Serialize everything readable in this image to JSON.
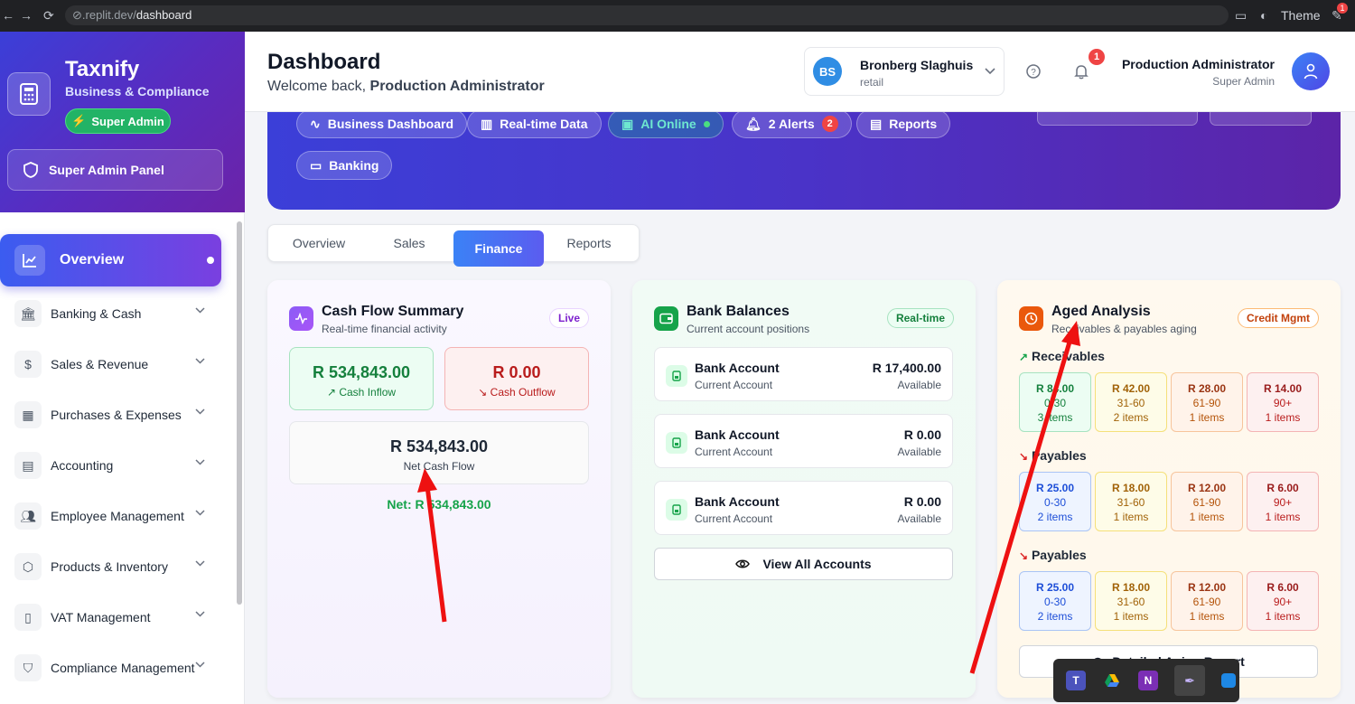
{
  "browser": {
    "url_prefix": ".replit.dev/",
    "url_path": "dashboard",
    "theme_label": "Theme",
    "ext_badge": "1"
  },
  "sidebar": {
    "brand": "Taxnify",
    "brand_sub": "Business & Compliance",
    "role_badge": "Super Admin",
    "admin_panel": "Super Admin Panel",
    "active_item": "Overview",
    "items": [
      {
        "label": "Banking & Cash",
        "icon": "bank-icon"
      },
      {
        "label": "Sales & Revenue",
        "icon": "dollar-icon"
      },
      {
        "label": "Purchases & Expenses",
        "icon": "receipt-icon"
      },
      {
        "label": "Accounting",
        "icon": "calculator-icon"
      },
      {
        "label": "Employee Management",
        "icon": "users-icon"
      },
      {
        "label": "Products & Inventory",
        "icon": "box-icon"
      },
      {
        "label": "VAT Management",
        "icon": "document-icon"
      },
      {
        "label": "Compliance Management",
        "icon": "shield-icon"
      }
    ]
  },
  "header": {
    "title": "Dashboard",
    "welcome_prefix": "Welcome back, ",
    "welcome_name": "Production Administrator",
    "company_initials": "BS",
    "company_name": "Bronberg Slaghuis",
    "company_type": "retail",
    "notifications": "1",
    "user_name": "Production Administrator",
    "user_role": "Super Admin"
  },
  "hero": {
    "pills": [
      "Business Dashboard",
      "Real-time Data",
      "AI Online",
      "2 Alerts",
      "Reports",
      "Banking"
    ],
    "alerts_count": "2"
  },
  "tabs": [
    "Overview",
    "Sales",
    "Finance",
    "Reports"
  ],
  "active_tab": "Finance",
  "cashflow": {
    "title": "Cash Flow Summary",
    "subtitle": "Real-time financial activity",
    "tag": "Live",
    "inflow": "R 534,843.00",
    "inflow_label": "Cash Inflow",
    "outflow": "R 0.00",
    "outflow_label": "Cash Outflow",
    "net": "R 534,843.00",
    "net_label": "Net Cash Flow",
    "net_line": "Net: R 534,843.00"
  },
  "bank": {
    "title": "Bank Balances",
    "subtitle": "Current account positions",
    "tag": "Real-time",
    "accounts": [
      {
        "name": "Bank Account",
        "type": "Current Account",
        "amount": "R 17,400.00",
        "status": "Available"
      },
      {
        "name": "Bank Account",
        "type": "Current Account",
        "amount": "R 0.00",
        "status": "Available"
      },
      {
        "name": "Bank Account",
        "type": "Current Account",
        "amount": "R 0.00",
        "status": "Available"
      }
    ],
    "view_all": "View All Accounts"
  },
  "aged": {
    "title": "Aged Analysis",
    "subtitle": "Receivables & payables aging",
    "tag": "Credit Mgmt",
    "sections": [
      {
        "label": "Receivables",
        "cells": [
          {
            "amount": "R 84.00",
            "range": "0-30",
            "items": "3 items"
          },
          {
            "amount": "R 42.00",
            "range": "31-60",
            "items": "2 items"
          },
          {
            "amount": "R 28.00",
            "range": "61-90",
            "items": "1 items"
          },
          {
            "amount": "R 14.00",
            "range": "90+",
            "items": "1 items"
          }
        ]
      },
      {
        "label": "Payables",
        "cells": [
          {
            "amount": "R 25.00",
            "range": "0-30",
            "items": "2 items"
          },
          {
            "amount": "R 18.00",
            "range": "31-60",
            "items": "1 items"
          },
          {
            "amount": "R 12.00",
            "range": "61-90",
            "items": "1 items"
          },
          {
            "amount": "R 6.00",
            "range": "90+",
            "items": "1 items"
          }
        ]
      },
      {
        "label": "Payables",
        "cells": [
          {
            "amount": "R 25.00",
            "range": "0-30",
            "items": "2 items"
          },
          {
            "amount": "R 18.00",
            "range": "31-60",
            "items": "1 items"
          },
          {
            "amount": "R 12.00",
            "range": "61-90",
            "items": "1 items"
          },
          {
            "amount": "R 6.00",
            "range": "90+",
            "items": "1 items"
          }
        ]
      }
    ],
    "report_button": "Detailed Aging Report"
  },
  "colors": {
    "accent": "#4f46e5",
    "hero_start": "#3b3fd8",
    "hero_end": "#5c24a8",
    "success": "#16a34a",
    "danger": "#dc2626",
    "annotation": "#ee1111"
  }
}
